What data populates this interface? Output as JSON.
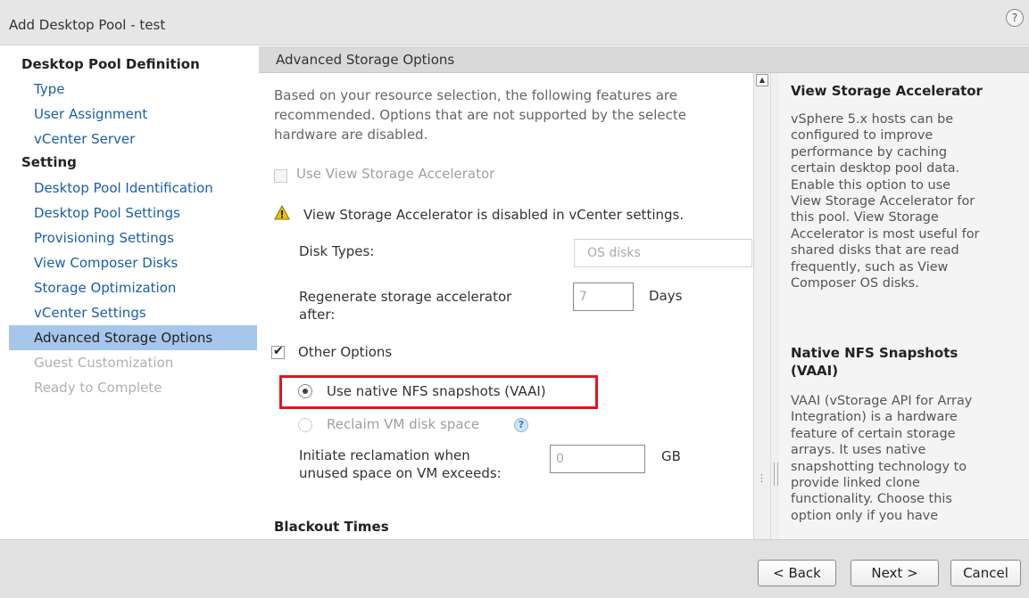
{
  "window": {
    "title": "Add Desktop Pool - test",
    "help_glyph": "?"
  },
  "nav": {
    "section_definition": "Desktop Pool Definition",
    "item_type": "Type",
    "item_user_assignment": "User Assignment",
    "item_vcenter_server": "vCenter Server",
    "section_setting": "Setting",
    "item_pool_identification": "Desktop Pool Identification",
    "item_pool_settings": "Desktop Pool Settings",
    "item_provisioning": "Provisioning Settings",
    "item_composer_disks": "View Composer Disks",
    "item_storage_optimization": "Storage Optimization",
    "item_vcenter_settings": "vCenter Settings",
    "item_advanced_storage": "Advanced Storage Options",
    "item_guest_customization": "Guest Customization",
    "item_ready": "Ready to Complete"
  },
  "panel": {
    "header": "Advanced Storage Options",
    "intro_line1": "Based on your resource selection, the following features are",
    "intro_line2": "recommended. Options that are not supported by the selecte",
    "intro_line3": "hardware are disabled.",
    "use_vsa_label": "Use View Storage Accelerator",
    "use_vsa_checked": false,
    "vsa_warning": "View Storage Accelerator is disabled in vCenter settings.",
    "disk_types_label": "Disk Types:",
    "disk_types_value": "OS disks",
    "regen_label_line1": "Regenerate storage accelerator",
    "regen_label_line2": "after:",
    "regen_value": "7",
    "regen_unit": "Days",
    "other_options_label": "Other Options",
    "other_options_checked": true,
    "nfs_snapshots_label": "Use native NFS snapshots (VAAI)",
    "nfs_snapshots_selected": true,
    "reclaim_label": "Reclaim VM disk space",
    "reclaim_help_glyph": "?",
    "reclaim_threshold_line1": "Initiate reclamation when",
    "reclaim_threshold_line2": "unused space on VM exceeds:",
    "reclaim_threshold_value": "0",
    "reclaim_threshold_unit": "GB",
    "blackout_heading": "Blackout Times"
  },
  "help": {
    "heading1": "View Storage Accelerator",
    "text1": [
      "vSphere 5.x hosts can be",
      "configured to improve",
      "performance by caching",
      "certain desktop pool data.",
      "Enable this option to use",
      "View Storage Accelerator for",
      "this pool. View Storage",
      "Accelerator is most useful for",
      "shared disks that are read",
      "frequently, such as View",
      "Composer OS disks."
    ],
    "heading2_line1": "Native NFS Snapshots",
    "heading2_line2": "(VAAI)",
    "text2": [
      "VAAI (vStorage API for Array",
      "Integration) is a hardware",
      "feature of certain storage",
      "arrays. It uses native",
      "snapshotting technology to",
      "provide linked clone",
      "functionality. Choose this",
      "option only if you have"
    ]
  },
  "footer": {
    "back_label": "< Back",
    "next_label": "Next >",
    "cancel_label": "Cancel"
  },
  "colors": {
    "highlight": "#e3151a",
    "link": "#1a5fa8",
    "active_nav": "#a6c6ec"
  }
}
